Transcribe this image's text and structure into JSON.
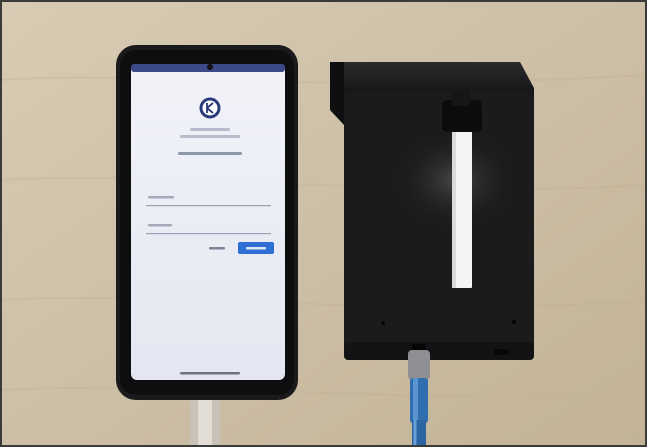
{
  "photo": {
    "subject_items": [
      "smartphone",
      "3d-printed-device",
      "usb-cable"
    ]
  },
  "colors": {
    "table": "#cdbfa6",
    "phone_body": "#1a1a1c",
    "screen": "#eef0f7",
    "device_body": "#1b1b1d",
    "slider": "#f4f4f4",
    "cable": "#2f6fb0",
    "accent": "#2f6fd6"
  },
  "phone_screen": {
    "app_logo_icon": "app-logo-icon",
    "app_title_line1": "",
    "app_title_line2": "",
    "app_heading": "",
    "username_placeholder": "",
    "password_placeholder": "",
    "secondary_button_label": "",
    "primary_button_label": ""
  }
}
